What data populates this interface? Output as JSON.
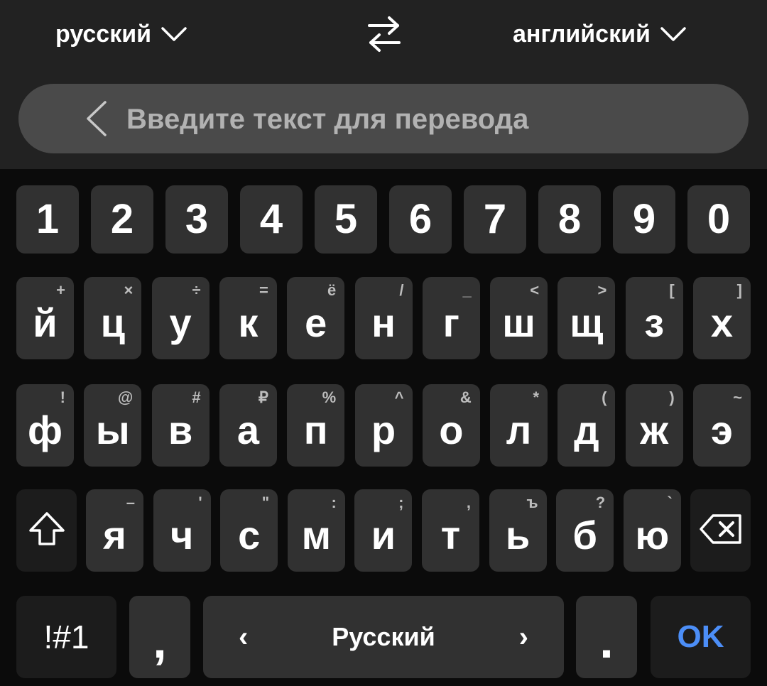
{
  "translator": {
    "source_language": "русский",
    "target_language": "английский",
    "input": {
      "value": "",
      "placeholder": "Введите текст для перевода"
    }
  },
  "keyboard": {
    "numbers": [
      "1",
      "2",
      "3",
      "4",
      "5",
      "6",
      "7",
      "8",
      "9",
      "0"
    ],
    "row1": [
      {
        "key": "й",
        "hint": "+"
      },
      {
        "key": "ц",
        "hint": "×"
      },
      {
        "key": "у",
        "hint": "÷"
      },
      {
        "key": "к",
        "hint": "="
      },
      {
        "key": "е",
        "hint": "ё"
      },
      {
        "key": "н",
        "hint": "/"
      },
      {
        "key": "г",
        "hint": "_"
      },
      {
        "key": "ш",
        "hint": "<"
      },
      {
        "key": "щ",
        "hint": ">"
      },
      {
        "key": "з",
        "hint": "["
      },
      {
        "key": "х",
        "hint": "]"
      }
    ],
    "row2": [
      {
        "key": "ф",
        "hint": "!"
      },
      {
        "key": "ы",
        "hint": "@"
      },
      {
        "key": "в",
        "hint": "#"
      },
      {
        "key": "а",
        "hint": "₽"
      },
      {
        "key": "п",
        "hint": "%"
      },
      {
        "key": "р",
        "hint": "^"
      },
      {
        "key": "о",
        "hint": "&"
      },
      {
        "key": "л",
        "hint": "*"
      },
      {
        "key": "д",
        "hint": "("
      },
      {
        "key": "ж",
        "hint": ")"
      },
      {
        "key": "э",
        "hint": "~"
      }
    ],
    "row3": [
      {
        "key": "я",
        "hint": "–"
      },
      {
        "key": "ч",
        "hint": "'"
      },
      {
        "key": "с",
        "hint": "\""
      },
      {
        "key": "м",
        "hint": ":"
      },
      {
        "key": "и",
        "hint": ";"
      },
      {
        "key": "т",
        "hint": ","
      },
      {
        "key": "ь",
        "hint": "ъ"
      },
      {
        "key": "б",
        "hint": "?"
      },
      {
        "key": "ю",
        "hint": "`"
      }
    ],
    "symbols_label": "!#1",
    "comma_label": ",",
    "space_label": "Русский",
    "space_left_arrow": "‹",
    "space_right_arrow": "›",
    "period_label": ".",
    "enter_label": "OK",
    "icons": {
      "shift": "shift-icon",
      "backspace": "backspace-icon",
      "swap": "swap-languages-icon",
      "back": "chevron-left-icon",
      "dropdown": "chevron-down-icon"
    },
    "colors": {
      "key_background": "#313131",
      "function_key_background": "#1c1c1c",
      "accent": "#4c8ef7",
      "header_background": "#222222",
      "input_background": "#4a4a4a"
    }
  }
}
